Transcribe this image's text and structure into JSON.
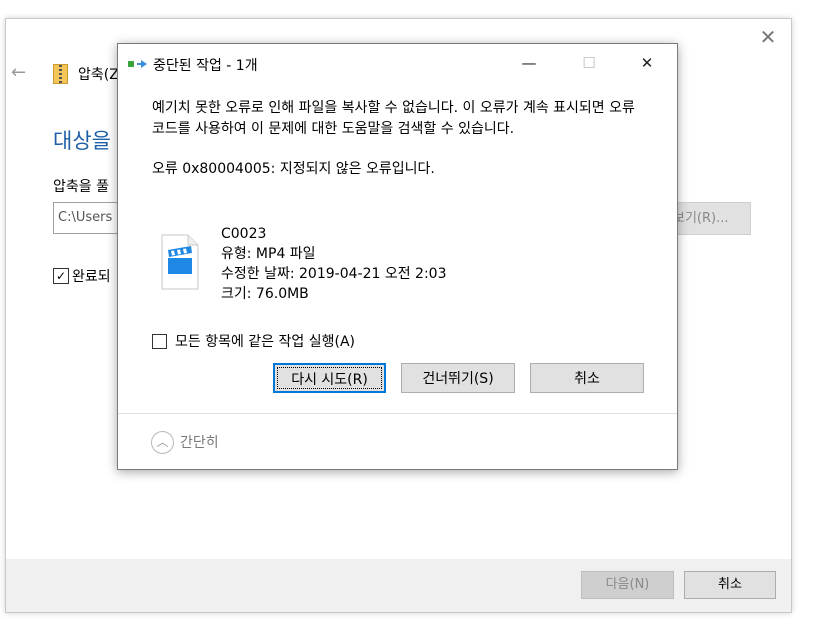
{
  "background_window": {
    "title": "압축(ZI",
    "heading": "대상을",
    "folder_label": "압축을 풀",
    "path_value": "C:\\Users",
    "browse_label": "보기(R)...",
    "check_label": "완료되",
    "next_label": "다음(N)",
    "cancel_label": "취소"
  },
  "dialog": {
    "title": "중단된 작업 - 1개",
    "message": "예기치 못한 오류로 인해 파일을 복사할 수 없습니다. 이 오류가 계속 표시되면 오류 코드를 사용하여 이 문제에 대한 도움말을 검색할 수 있습니다.",
    "error_code": "오류 0x80004005: 지정되지 않은 오류입니다.",
    "file": {
      "name": "C0023",
      "type": "유형: MP4 파일",
      "modified": "수정한 날짜: 2019-04-21 오전 2:03",
      "size": "크기: 76.0MB"
    },
    "apply_all_label": "모든 항목에 같은 작업 실행(A)",
    "buttons": {
      "retry": "다시 시도(R)",
      "skip": "건너뛰기(S)",
      "cancel": "취소"
    },
    "collapse_label": "간단히"
  },
  "colors": {
    "accent": "#0078d7",
    "heading_blue": "#1e5fa6",
    "file_icon_blue": "#1e88e5"
  }
}
